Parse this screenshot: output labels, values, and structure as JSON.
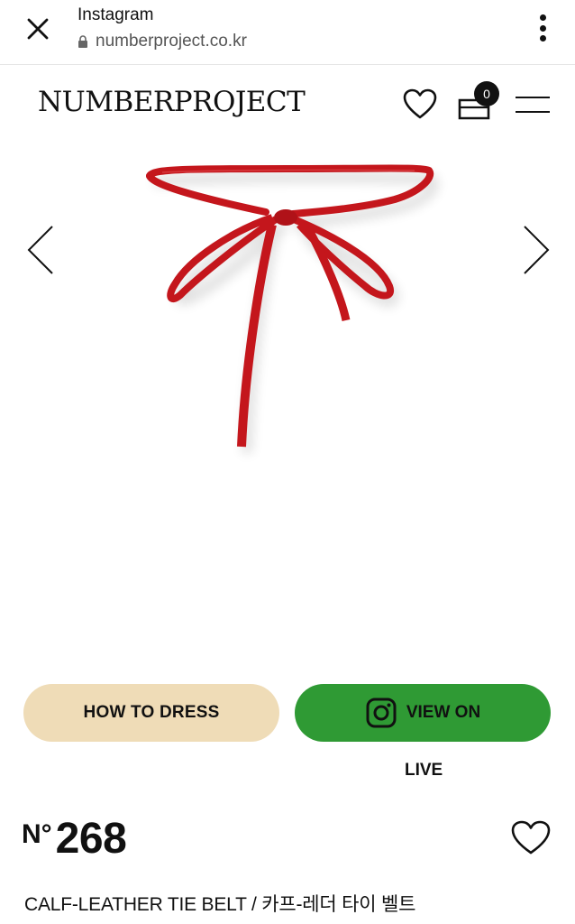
{
  "browser": {
    "title": "Instagram",
    "url": "numberproject.co.kr",
    "close_icon": "close-icon",
    "menu_icon": "kebab-menu-icon"
  },
  "header": {
    "logo": "NUMBERPROJECT",
    "cart_count": "0",
    "icons": [
      "heart-icon",
      "cart-icon",
      "hamburger-menu-icon"
    ]
  },
  "gallery": {
    "image": "red calf-leather tie belt tied in a bow",
    "prev_icon": "chevron-left-icon",
    "next_icon": "chevron-right-icon",
    "belt_color": "#c4161c"
  },
  "actions": {
    "how_to_dress": "HOW TO DRESS",
    "view_on": "VIEW ON",
    "live": "LIVE",
    "how_to_dress_color": "#efdcb7",
    "view_on_color": "#2f9a34"
  },
  "product": {
    "number_prefix": "N°",
    "number": "268",
    "title": "CALF-LEATHER TIE BELT / 카프-레더 타이 벨트"
  }
}
